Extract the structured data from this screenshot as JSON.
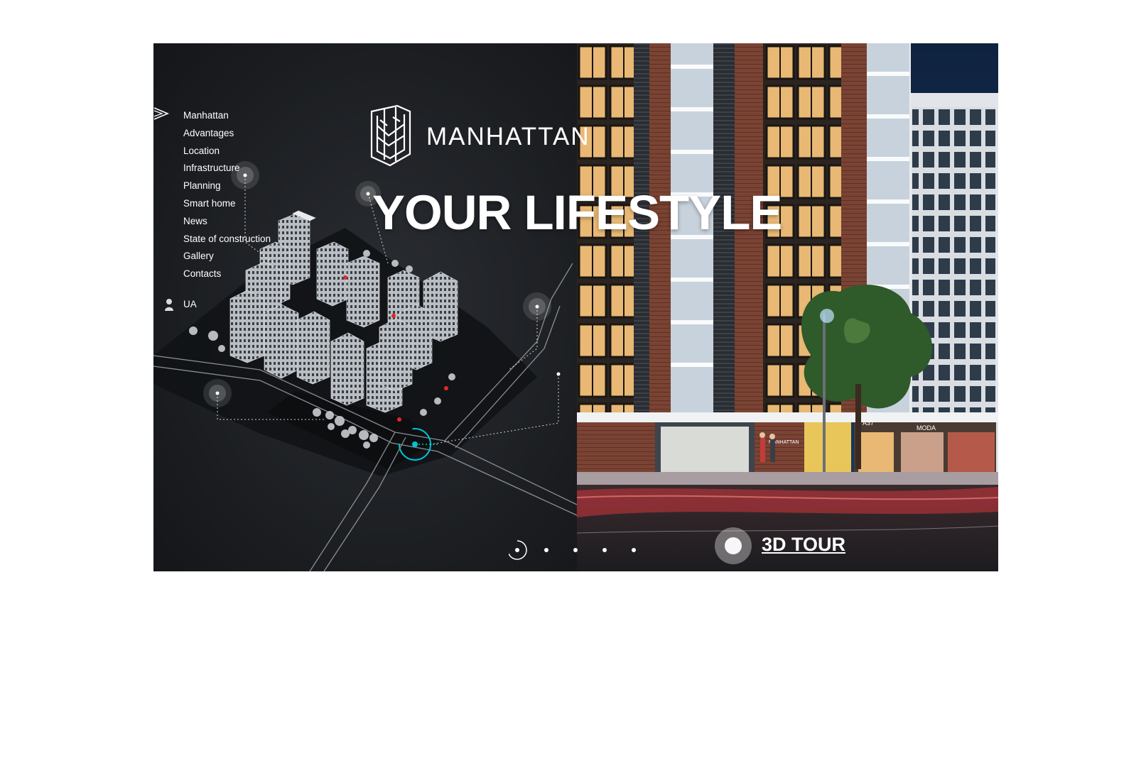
{
  "brand": {
    "name": "MANHATTAN"
  },
  "menu": {
    "items": [
      {
        "label": "Manhattan"
      },
      {
        "label": "Advantages"
      },
      {
        "label": "Location"
      },
      {
        "label": "Infrastructure"
      },
      {
        "label": "Planning"
      },
      {
        "label": "Smart home"
      },
      {
        "label": "News"
      },
      {
        "label": "State of construction"
      },
      {
        "label": "Gallery"
      },
      {
        "label": "Contacts"
      }
    ],
    "language": "UA"
  },
  "hero": {
    "headline": "YOUR LIFESTYLE"
  },
  "tour": {
    "label": "3D TOUR"
  },
  "slider": {
    "count": 5,
    "active": 1
  },
  "signage": {
    "facade_logo": "MANHATTAN",
    "shop_1": "A37",
    "shop_2": "MODA"
  },
  "colors": {
    "left_bg": "#1b1e22",
    "accent": "#00c4d6",
    "marker": "#e0282c",
    "text": "#ffffff"
  },
  "icons": [
    "menu-arrow-icon",
    "logo-mark-icon",
    "language-icon",
    "hotspot-icon",
    "map-pin-icon",
    "tour-icon"
  ]
}
